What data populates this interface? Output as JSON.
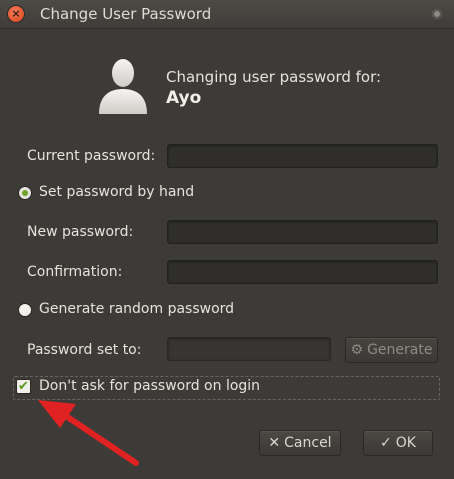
{
  "window": {
    "title": "Change User Password"
  },
  "header": {
    "prompt": "Changing user password for:",
    "username": "Ayo"
  },
  "fields": {
    "current_label": "Current password:",
    "current_value": "",
    "set_by_hand_label": "Set password by hand",
    "new_label": "New password:",
    "new_value": "",
    "confirm_label": "Confirmation:",
    "confirm_value": "",
    "random_label": "Generate random password",
    "set_to_label": "Password set to:",
    "set_to_value": "",
    "generate_label": "Generate"
  },
  "options": {
    "dont_ask_label": "Don't ask for password on login",
    "dont_ask_checked": true,
    "set_by_hand_selected": true
  },
  "actions": {
    "cancel_label": "Cancel",
    "ok_label": "OK"
  },
  "icons": {
    "close": "close-icon",
    "menu": "menu-icon",
    "user": "user-avatar-icon",
    "generate": "gears-icon",
    "cancel": "x-icon",
    "ok": "checkmark-icon",
    "annotation": "red-arrow"
  },
  "colors": {
    "accent": "#6aa527",
    "close": "#e05a2b",
    "annotation": "#e02222"
  }
}
